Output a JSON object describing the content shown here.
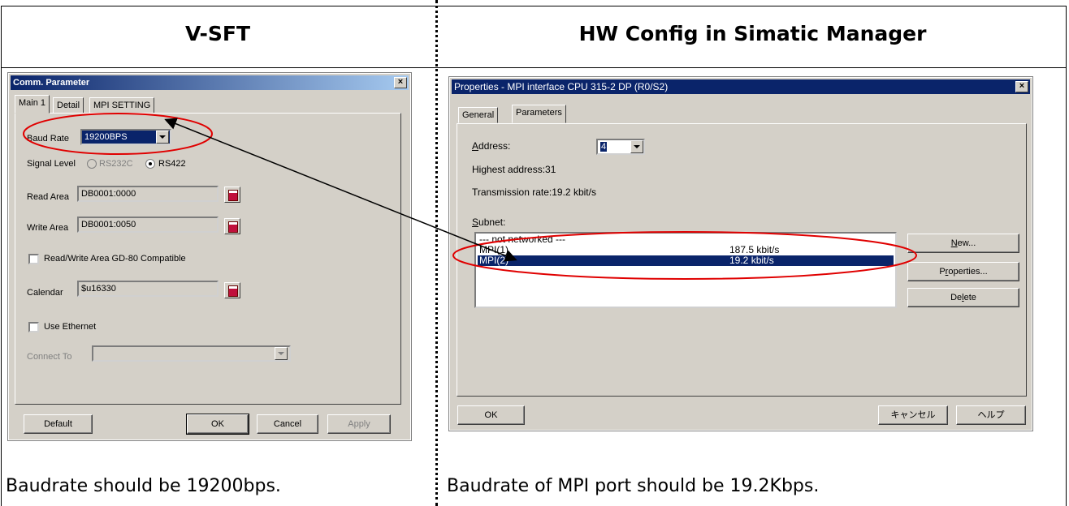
{
  "headers": {
    "left": "V-SFT",
    "right": "HW Config in Simatic Manager"
  },
  "captions": {
    "left": "Baudrate should be 19200bps.",
    "right": "Baudrate of MPI port should be 19.2Kbps."
  },
  "vsft": {
    "title": "Comm. Parameter",
    "tabs": [
      "Main 1",
      "Detail",
      "MPI SETTING"
    ],
    "baud_rate_label": "Baud Rate",
    "baud_rate_value": "19200BPS",
    "signal_level_label": "Signal Level",
    "signal_options": [
      "RS232C",
      "RS422"
    ],
    "selected_signal": "RS422",
    "read_area_label": "Read Area",
    "read_area_value": "DB0001:0000",
    "write_area_label": "Write Area",
    "write_area_value": "DB0001:0050",
    "compatible_label": "Read/Write Area GD-80 Compatible",
    "calendar_label": "Calendar",
    "calendar_value": "$u16330",
    "use_ethernet_label": "Use Ethernet",
    "connect_to_label": "Connect To",
    "buttons": {
      "default": "Default",
      "ok": "OK",
      "cancel": "Cancel",
      "apply": "Apply"
    }
  },
  "mpi": {
    "title": "Properties - MPI interface  CPU 315-2 DP (R0/S2)",
    "tabs": [
      "General",
      "Parameters"
    ],
    "address_label": "Address:",
    "address_value": "4",
    "highest_address": "Highest address:31",
    "transmission_rate": "Transmission rate:19.2 kbit/s",
    "subnet_label": "Subnet:",
    "subnets": [
      {
        "name": "--- not networked ---",
        "rate": ""
      },
      {
        "name": "MPI(1)",
        "rate": "187.5 kbit/s"
      },
      {
        "name": "MPI(2)",
        "rate": "19.2 kbit/s"
      }
    ],
    "selected_subnet": "MPI(2)",
    "side_buttons": {
      "new": "New...",
      "properties": "Properties...",
      "delete": "Delete"
    },
    "footer_buttons": {
      "ok": "OK",
      "cancel": "キャンセル",
      "help": "ヘルプ"
    }
  },
  "annotation_color": "#e00000"
}
